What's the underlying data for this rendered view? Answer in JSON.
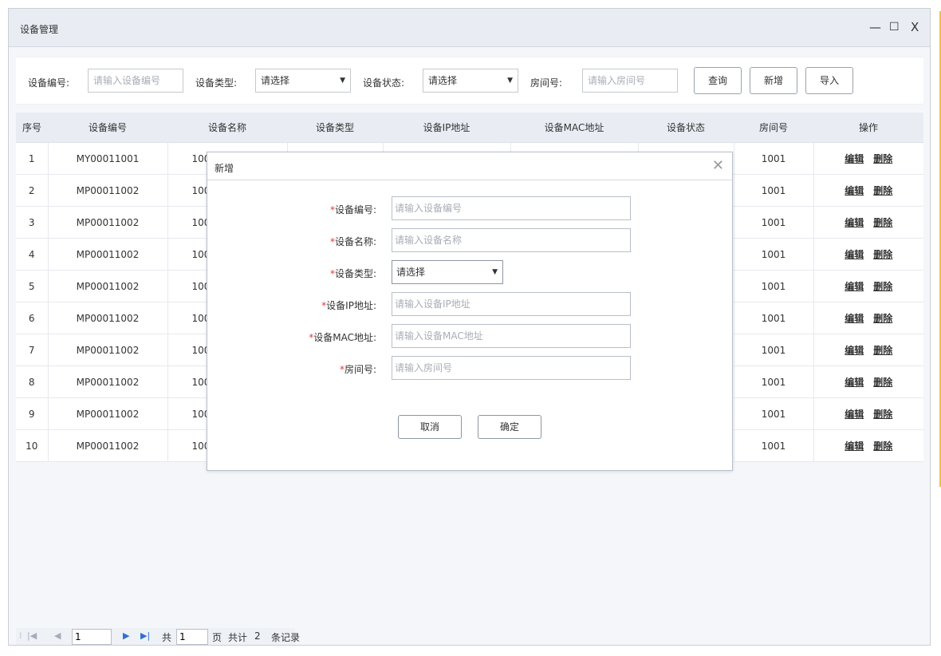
{
  "window": {
    "title": "设备管理",
    "minimize": "—",
    "maximize": "☐",
    "close": "X"
  },
  "search": {
    "device_no_label": "设备编号:",
    "device_no_placeholder": "请输入设备编号",
    "device_type_label": "设备类型:",
    "device_type_value": "请选择",
    "device_status_label": "设备状态:",
    "device_status_value": "请选择",
    "room_label": "房间号:",
    "room_placeholder": "请输入房间号",
    "query_button": "查询",
    "add_button": "新增",
    "import_button": "导入"
  },
  "table": {
    "columns": [
      "序号",
      "设备编号",
      "设备名称",
      "设备类型",
      "设备IP地址",
      "设备MAC地址",
      "设备状态",
      "房间号",
      "操作"
    ],
    "rows": [
      {
        "idx": "1",
        "code": "MY00011001",
        "name": "100",
        "room": "1001"
      },
      {
        "idx": "2",
        "code": "MP00011002",
        "name": "100",
        "room": "1001"
      },
      {
        "idx": "3",
        "code": "MP00011002",
        "name": "100",
        "room": "1001"
      },
      {
        "idx": "4",
        "code": "MP00011002",
        "name": "100",
        "room": "1001"
      },
      {
        "idx": "5",
        "code": "MP00011002",
        "name": "100",
        "room": "1001"
      },
      {
        "idx": "6",
        "code": "MP00011002",
        "name": "100",
        "room": "1001"
      },
      {
        "idx": "7",
        "code": "MP00011002",
        "name": "100",
        "room": "1001"
      },
      {
        "idx": "8",
        "code": "MP00011002",
        "name": "100",
        "room": "1001"
      },
      {
        "idx": "9",
        "code": "MP00011002",
        "name": "100",
        "room": "1001"
      },
      {
        "idx": "10",
        "code": "MP00011002",
        "name": "100",
        "room": "1001"
      }
    ],
    "edit_label": "编辑",
    "delete_label": "删除"
  },
  "pager": {
    "current_page": "1",
    "total_prefix": "共",
    "total_pages": "1",
    "page_suffix": "页",
    "records_prefix": "共计",
    "records_count": "2",
    "records_suffix": "条记录"
  },
  "dialog": {
    "title": "新增",
    "close": "✕",
    "fields": [
      {
        "required": "*",
        "label": "设备编号:",
        "placeholder": "请输入设备编号"
      },
      {
        "required": "*",
        "label": "设备名称:",
        "placeholder": "请输入设备名称"
      },
      {
        "required": "*",
        "label": "设备类型:",
        "value": "请选择"
      },
      {
        "required": "*",
        "label": "设备IP地址:",
        "placeholder": "请输入设备IP地址"
      },
      {
        "required": "*",
        "label": "设备MAC地址:",
        "placeholder": "请输入设备MAC地址"
      },
      {
        "required": "*",
        "label": "房间号:",
        "placeholder": "请输入房间号"
      }
    ],
    "cancel_button": "取消",
    "confirm_button": "确定"
  },
  "colors": {
    "titlebar_bg": "#e9edf3",
    "required_mark": "#e03a3a",
    "table_header_bg": "#e9edf3"
  }
}
